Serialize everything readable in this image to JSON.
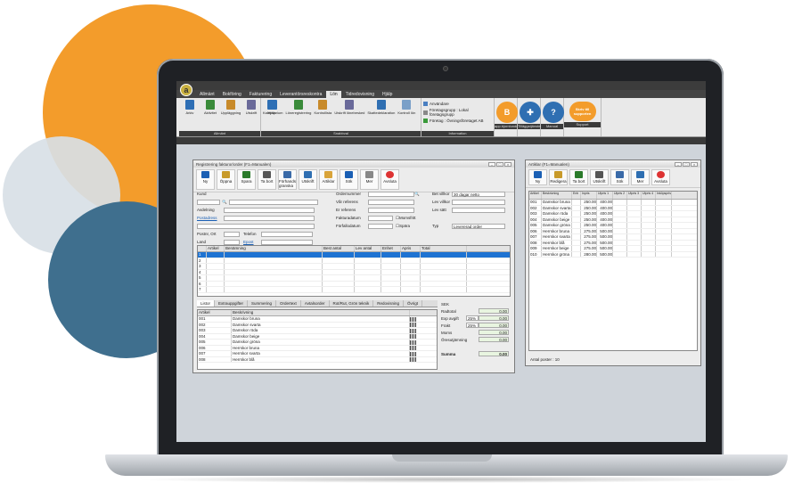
{
  "app": {
    "menu": [
      "Allmänt",
      "Bokföring",
      "Fakturering",
      "Leverantörsreskontra",
      "Lön",
      "Tidredovisning",
      "Hjälp"
    ],
    "active_menu": "Lön",
    "ribbon_groups": [
      {
        "label": "Allmänt",
        "buttons": [
          "Arkiv",
          "Aktivitet",
          "Uppläggning",
          "Utskrift",
          "Hjälp"
        ]
      },
      {
        "label": "Snabbval",
        "buttons": [
          "Kalendarium",
          "Löneregistrering",
          "Kontrollista",
          "Utskrift lönebesked",
          "Skattedeklaration",
          "Kontroll lön"
        ]
      }
    ],
    "info": {
      "users": "Användare",
      "group": "Företagsgrupp : Lokal företagsgrupp",
      "company": "Företag : Övningsföretaget AB",
      "label": "Information"
    },
    "circles": [
      {
        "label": "app.bjornlunden.se",
        "text": "B",
        "color": "#f39c2b"
      },
      {
        "label": "Tilläggstjänster",
        "text": "✚",
        "color": "#2f6fb2"
      },
      {
        "label": "Manual",
        "text": "?",
        "color": "#2f6fb2"
      },
      {
        "label": "Support",
        "text": "Skriv till supporten",
        "color": "#f39c2b"
      }
    ]
  },
  "invoice_window": {
    "title": "Registrering fakturor/order (F1=Manualen)",
    "toolbar": [
      "Ny",
      "Öppna",
      "Spara",
      "Ta bort",
      "Förhands granska",
      "Utskrift",
      "Artiklar",
      "Sök",
      "Mer",
      "Avsluta"
    ],
    "fields_left": {
      "kund": "Kund",
      "avdelning": "Avdelning",
      "postadress": "Postadress",
      "postnr": "Postnr, Ort",
      "telefon": "Telefon",
      "land": "Land",
      "epost": "Epost"
    },
    "fields_mid": {
      "ordernummer": "Ordernummer",
      "var_ref": "Vår referens",
      "er_ref": "Er referens",
      "fakturadatum": "Fakturadatum",
      "forfallodatum": "Förfallodatum",
      "momsfritt": "Momsfritt",
      "spara": "Spära"
    },
    "fields_right": {
      "bet_villkor": "Bet villkor",
      "bet_villkor_val": "30 dagar netto",
      "lev_villkor": "Lev villkor",
      "lev_satt": "Lev sätt",
      "typ": "Typ",
      "typ_val": "Levererad order"
    },
    "grid_headers": [
      "Artikel",
      "Benämning",
      "Best antal",
      "Lev antal",
      "Enhet",
      "Apris",
      "Total"
    ],
    "grid_rows": [
      "1",
      "2",
      "3",
      "4",
      "5",
      "6",
      "7"
    ],
    "tabs": [
      "Listor",
      "Extrauppgifter",
      "Summering",
      "Ordertext",
      "Avtalsorder",
      "Rot/Rut, Grön teknik",
      "Redovisning",
      "Övrigt"
    ],
    "list_headers": [
      "Artikel",
      "Beskrivning"
    ],
    "list_rows": [
      [
        "001",
        "Damskor bruna"
      ],
      [
        "002",
        "Damskor svarta"
      ],
      [
        "003",
        "Damskor röda"
      ],
      [
        "004",
        "Damskor beige"
      ],
      [
        "005",
        "Damskor gröna"
      ],
      [
        "006",
        "Herrskor bruna"
      ],
      [
        "007",
        "Herrskor svarta"
      ],
      [
        "008",
        "Herrskor blå"
      ]
    ],
    "summary": {
      "currency": "SEK",
      "radtotal": "Radtotal",
      "exp_avgift": "Exp avgift",
      "frakt": "Frakt",
      "moms": "Moms",
      "oresutjamning": "Öresutjämning",
      "summa": "Summa",
      "vat": "25%",
      "zero": "0.00"
    }
  },
  "article_window": {
    "title": "Artiklar (F1=Manualen)",
    "toolbar": [
      "Ny",
      "Redigera",
      "Ta bort",
      "Utskrift",
      "Sök",
      "Mer",
      "Avsluta"
    ],
    "headers": [
      "Artikel",
      "Beskrivning",
      "Enh",
      "Inpris",
      "Utpris 1",
      "Utpris 2",
      "Utpris 3",
      "Utpris 4",
      "Inköpspris"
    ],
    "rows": [
      [
        "001",
        "Damskor bruna",
        "",
        "250.00",
        "400.00"
      ],
      [
        "002",
        "Damskor svarta",
        "",
        "250.00",
        "400.00"
      ],
      [
        "003",
        "Damskor röda",
        "",
        "250.00",
        "400.00"
      ],
      [
        "004",
        "Damskor beige",
        "",
        "250.00",
        "400.00"
      ],
      [
        "005",
        "Damskor gröna",
        "",
        "250.00",
        "400.00"
      ],
      [
        "006",
        "Herrskor bruna",
        "",
        "275.00",
        "500.00"
      ],
      [
        "007",
        "Herrskor svarta",
        "",
        "275.00",
        "500.00"
      ],
      [
        "008",
        "Herrskor blå",
        "",
        "275.00",
        "500.00"
      ],
      [
        "009",
        "Herrskor beige",
        "",
        "275.00",
        "500.00"
      ],
      [
        "010",
        "Herrskor gröna",
        "",
        "280.00",
        "500.00"
      ]
    ],
    "footer": "Antal poster : 10"
  }
}
